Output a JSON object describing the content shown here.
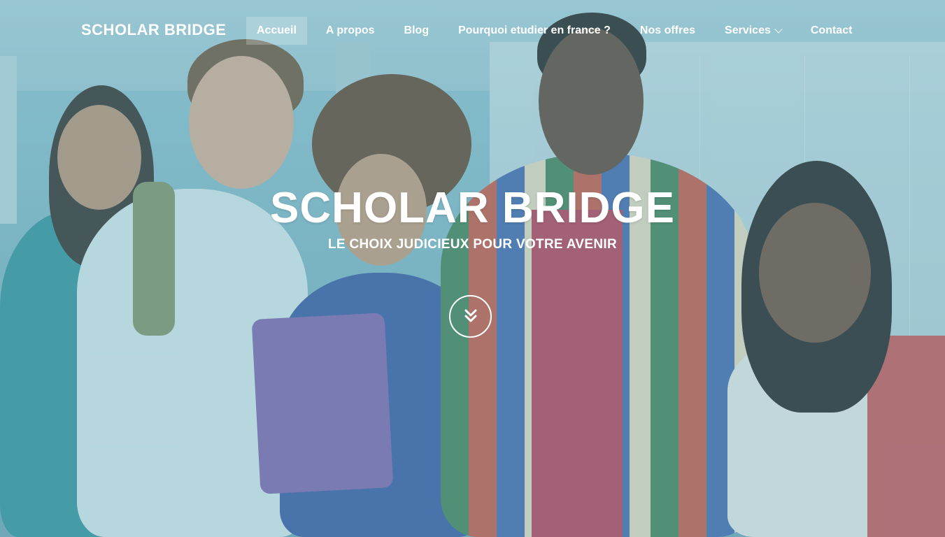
{
  "brand": {
    "name": "SCHOLAR BRIDGE"
  },
  "nav": {
    "items": [
      {
        "label": "Accueil",
        "active": true
      },
      {
        "label": "A propos",
        "active": false
      },
      {
        "label": "Blog",
        "active": false
      },
      {
        "label": "Pourquoi etudier en france ?",
        "active": false
      },
      {
        "label": "Nos offres",
        "active": false
      },
      {
        "label": "Services",
        "active": false,
        "has_dropdown": true
      },
      {
        "label": "Contact",
        "active": false
      }
    ]
  },
  "hero": {
    "title": "SCHOLAR BRIDGE",
    "subtitle": "LE CHOIX JUDICIEUX POUR VOTRE AVENIR",
    "scroll_icon": "double-chevron-down-icon"
  },
  "colors": {
    "text": "#ffffff",
    "overlay": "#78b9c8",
    "active_nav_bg": "#ffffff38"
  }
}
